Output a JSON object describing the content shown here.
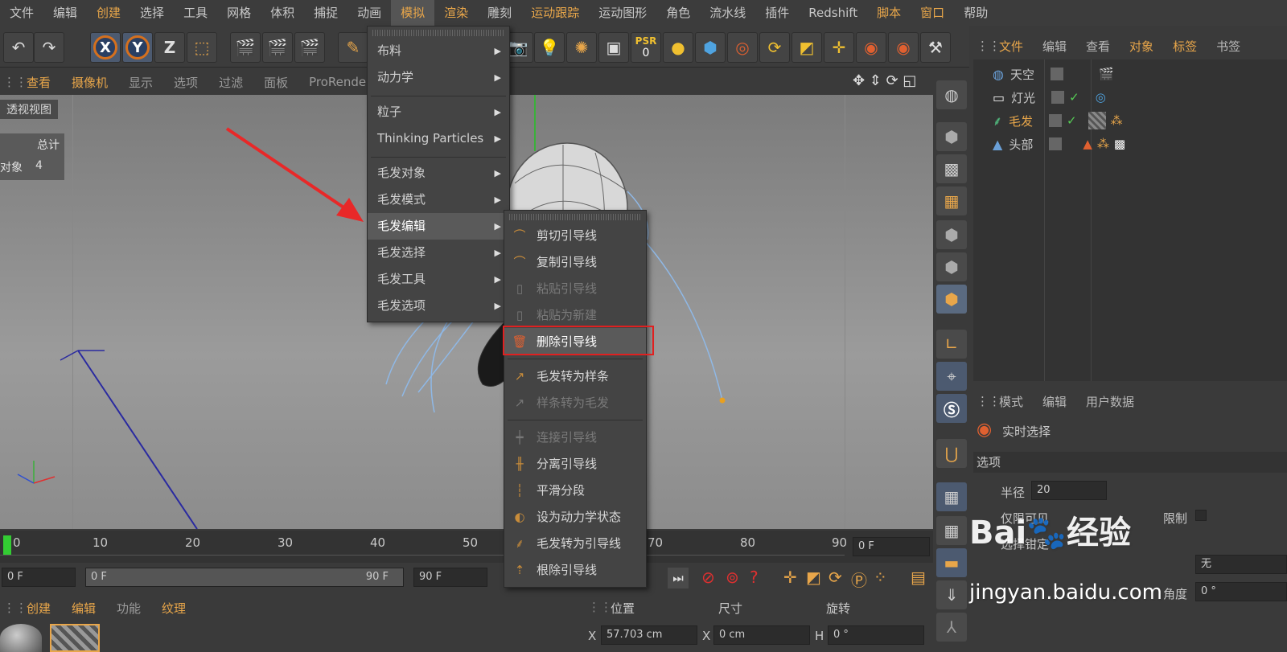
{
  "menubar": {
    "items": [
      "文件",
      "编辑",
      "创建",
      "选择",
      "工具",
      "网格",
      "体积",
      "捕捉",
      "动画",
      "模拟",
      "渲染",
      "雕刻",
      "运动跟踪",
      "运动图形",
      "角色",
      "流水线",
      "插件",
      "Redshift",
      "脚本",
      "窗口",
      "帮助"
    ]
  },
  "toolbar": {
    "axis_x": "X",
    "axis_y": "Y",
    "axis_z": "Z",
    "psr_label": "PSR",
    "psr_value": "0"
  },
  "viewport_header": {
    "items": [
      "查看",
      "摄像机",
      "显示",
      "选项",
      "过滤",
      "面板",
      "ProRender"
    ]
  },
  "viewport": {
    "label": "透视视图",
    "stats_header": "总计",
    "stats_label": "对象",
    "stats_value": "4"
  },
  "main_menu": {
    "items": [
      {
        "label": "布料",
        "submenu": true
      },
      {
        "label": "动力学",
        "submenu": true
      },
      {
        "label": "粒子",
        "submenu": true
      },
      {
        "label": "Thinking Particles",
        "submenu": true
      },
      {
        "label": "毛发对象",
        "submenu": true
      },
      {
        "label": "毛发模式",
        "submenu": true
      },
      {
        "label": "毛发编辑",
        "submenu": true,
        "highlighted": true
      },
      {
        "label": "毛发选择",
        "submenu": true
      },
      {
        "label": "毛发工具",
        "submenu": true
      },
      {
        "label": "毛发选项",
        "submenu": true
      }
    ]
  },
  "sub_menu": {
    "items": [
      {
        "label": "剪切引导线",
        "enabled": true,
        "icon": "cut-guide-icon"
      },
      {
        "label": "复制引导线",
        "enabled": true,
        "icon": "copy-guide-icon"
      },
      {
        "label": "粘贴引导线",
        "enabled": false,
        "icon": "paste-guide-icon"
      },
      {
        "label": "粘贴为新建",
        "enabled": false,
        "icon": "paste-new-icon"
      },
      {
        "label": "删除引导线",
        "enabled": true,
        "icon": "delete-guide-icon",
        "highlighted": true
      },
      {
        "label": "毛发转为样条",
        "enabled": true,
        "icon": "hair-to-spline-icon"
      },
      {
        "label": "样条转为毛发",
        "enabled": false,
        "icon": "spline-to-hair-icon"
      },
      {
        "label": "连接引导线",
        "enabled": false,
        "icon": "connect-guide-icon"
      },
      {
        "label": "分离引导线",
        "enabled": true,
        "icon": "split-guide-icon"
      },
      {
        "label": "平滑分段",
        "enabled": true,
        "icon": "smooth-segment-icon"
      },
      {
        "label": "设为动力学状态",
        "enabled": true,
        "icon": "dynamics-state-icon"
      },
      {
        "label": "毛发转为引导线",
        "enabled": true,
        "icon": "hair-to-guide-icon"
      },
      {
        "label": "根除引导线",
        "enabled": true,
        "icon": "root-guide-icon"
      }
    ]
  },
  "object_manager": {
    "tabs": [
      "文件",
      "编辑",
      "查看",
      "对象",
      "标签",
      "书签"
    ],
    "objects": [
      {
        "name": "天空",
        "color": "#c8c8c8"
      },
      {
        "name": "灯光",
        "color": "#c8c8c8"
      },
      {
        "name": "毛发",
        "color": "#e8a64a"
      },
      {
        "name": "头部",
        "color": "#c8c8c8"
      }
    ]
  },
  "attribute_manager": {
    "tabs": [
      "模式",
      "编辑",
      "用户数据"
    ],
    "tool_name": "实时选择",
    "section": "选项",
    "radius_label": "半径",
    "radius_value": "20",
    "visible_only_label": "仅限可见",
    "limit_label": "限制",
    "select_label": "选择钳定",
    "dropdown_value": "无",
    "angle_label": "角度",
    "angle_value": "0 °"
  },
  "timeline": {
    "ticks": [
      "0",
      "10",
      "20",
      "30",
      "40",
      "50",
      "70",
      "80",
      "90"
    ],
    "current_frame": "0 F"
  },
  "transport": {
    "start": "0 F",
    "range_start": "0 F",
    "range_end": "90 F",
    "end": "90 F"
  },
  "material_manager": {
    "tabs": [
      "创建",
      "编辑",
      "功能",
      "纹理"
    ]
  },
  "coord_manager": {
    "headers": [
      "位置",
      "尺寸",
      "旋转"
    ],
    "x_label": "X",
    "pos_x": "57.703 cm",
    "size_label": "X",
    "size_x": "0 cm",
    "rot_label": "H",
    "rot_h": "0 °"
  },
  "watermark": {
    "brand": "Bai",
    "brand_suffix": "经验",
    "url": "jingyan.baidu.com"
  },
  "colors": {
    "accent": "#e8a64a",
    "highlight_box": "#e02020",
    "arrow": "#e82828"
  }
}
